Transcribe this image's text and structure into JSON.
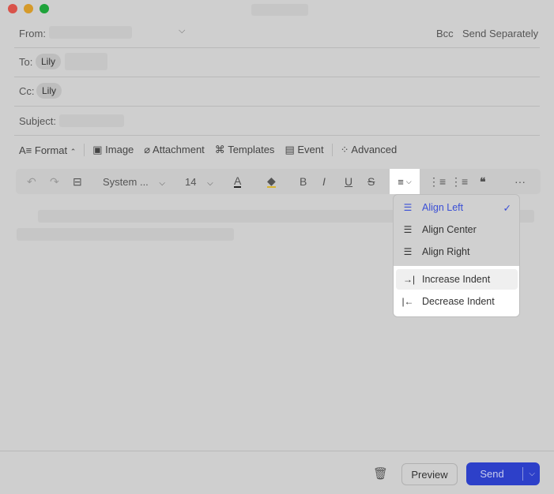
{
  "header": {
    "from_label": "From:",
    "bcc": "Bcc",
    "send_separately": "Send Separately",
    "to_label": "To:",
    "to_chip": "Lily",
    "cc_label": "Cc:",
    "cc_chip": "Lily",
    "subject_label": "Subject:"
  },
  "toolbar": {
    "format": "Format",
    "image": "Image",
    "attachment": "Attachment",
    "templates": "Templates",
    "event": "Event",
    "advanced": "Advanced"
  },
  "format_bar": {
    "font": "System ...",
    "size": "14",
    "bold": "B",
    "italic": "I",
    "underline": "U",
    "strike": "S",
    "quote": "❝",
    "more": "···"
  },
  "align_menu": {
    "items": [
      {
        "label": "Align Left",
        "selected": true
      },
      {
        "label": "Align Center"
      },
      {
        "label": "Align Right"
      },
      {
        "label": "Increase Indent"
      },
      {
        "label": "Decrease Indent"
      }
    ]
  },
  "footer": {
    "preview": "Preview",
    "send": "Send"
  },
  "colors": {
    "accent": "#3a4fd6",
    "send": "#2d40c9"
  }
}
